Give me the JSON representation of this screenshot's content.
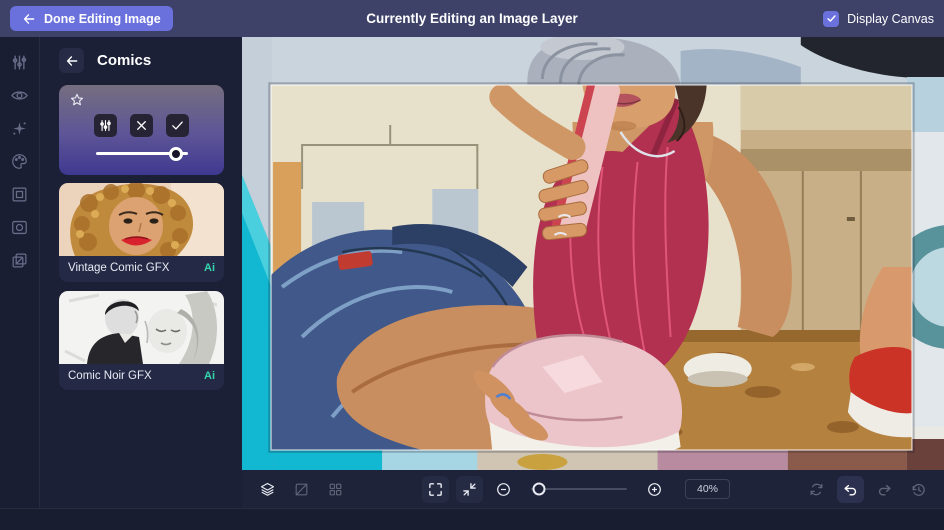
{
  "topbar": {
    "done_button": "Done Editing Image",
    "title": "Currently Editing an Image Layer",
    "display_canvas_label": "Display Canvas",
    "display_canvas_checked": true
  },
  "rail": {
    "icons": [
      "adjustments-icon",
      "eye-icon",
      "effects-icon",
      "palette-icon",
      "canvas-frame-icon",
      "vignette-icon",
      "duplicate-icon"
    ]
  },
  "panel": {
    "title": "Comics",
    "selected_filter": {
      "icons": [
        "adjust-icon",
        "discard-icon",
        "apply-icon"
      ],
      "favorite_icon": "star-icon",
      "strength_percent": 87
    },
    "filters": [
      {
        "label": "Vintage Comic GFX",
        "badge": "Ai"
      },
      {
        "label": "Comic Noir GFX",
        "badge": "Ai"
      }
    ]
  },
  "toolbar": {
    "left_icons": [
      "layers-icon",
      "edit-canvas-icon",
      "grid-icon"
    ],
    "center_icons": [
      "expand-icon",
      "fit-screen-icon",
      "zoom-out-icon",
      "zoom-in-icon"
    ],
    "right_icons": [
      "reset-icon",
      "undo-icon",
      "redo-icon",
      "history-icon"
    ],
    "zoom_percent": "40%",
    "zoom_slider_percent": 8
  },
  "colors": {
    "accent": "#6A71DC",
    "topbar_bg": "#3E4269",
    "panel_bg": "#1C2036",
    "toolbar_bg": "#1F2339",
    "ai_badge": "#35D6AE",
    "canvas_teal": "#12B7D1"
  }
}
